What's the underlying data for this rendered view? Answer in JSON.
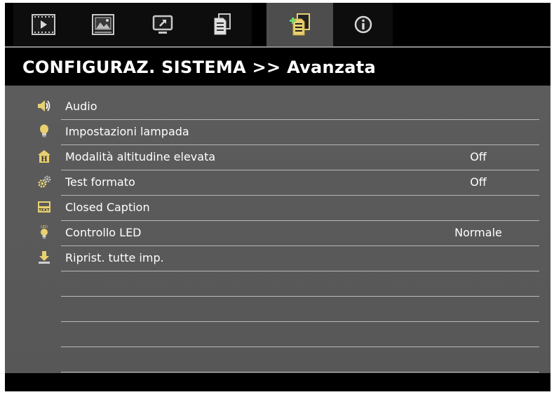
{
  "tabs": [
    {
      "icon": "film-play-icon",
      "active": false
    },
    {
      "icon": "picture-icon",
      "active": false
    },
    {
      "icon": "display-icon",
      "active": false
    },
    {
      "icon": "document-icon",
      "active": false
    },
    {
      "icon": "system-settings-icon",
      "active": true
    },
    {
      "icon": "info-icon",
      "active": false
    }
  ],
  "header": {
    "title": "CONFIGURAZ. SISTEMA >> Avanzata"
  },
  "menu": {
    "items": [
      {
        "icon": "speaker-icon",
        "label": "Audio",
        "value": ""
      },
      {
        "icon": "lamp-bulb-icon",
        "label": "Impostazioni lampada",
        "value": ""
      },
      {
        "icon": "high-altitude-icon",
        "label": "Modalità altitudine elevata",
        "value": "Off"
      },
      {
        "icon": "test-pattern-gears-icon",
        "label": "Test formato",
        "value": "Off"
      },
      {
        "icon": "closed-caption-text-icon",
        "label": "Closed Caption",
        "value": ""
      },
      {
        "icon": "led-bulb-icon",
        "label": "Controllo LED",
        "value": "Normale"
      },
      {
        "icon": "reset-download-icon",
        "label": "Riprist. tutte imp.",
        "value": ""
      }
    ],
    "empty_rows": 4
  },
  "colors": {
    "background": "#000000",
    "content_bg": "#5a5a5a",
    "active_tab": "#4d4d4d",
    "divider": "#b8b8b8",
    "text": "#ffffff",
    "icon_yellow": "#e8d070"
  }
}
